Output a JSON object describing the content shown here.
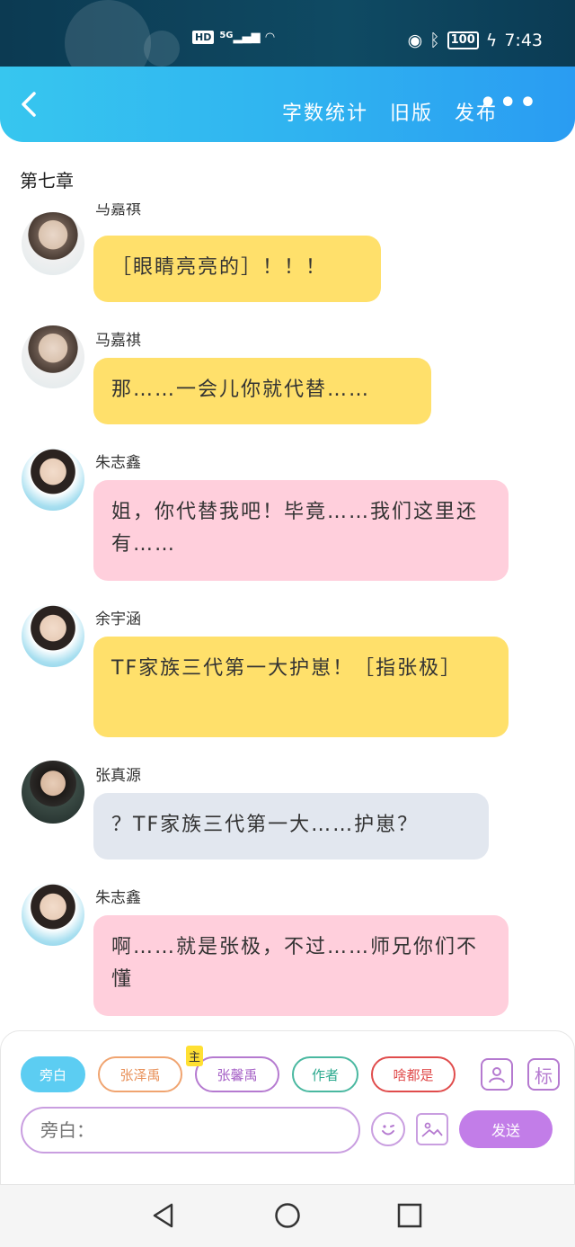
{
  "status_bar": {
    "network_badge": "HD",
    "signal_label": "5G",
    "battery": "100",
    "time": "7:43"
  },
  "title_bar": {
    "actions": [
      "字数统计",
      "旧版",
      "发布"
    ],
    "more": "•••"
  },
  "chapter_title": "第七章",
  "messages": [
    {
      "name": "马嘉祺",
      "text": "［眼睛亮亮的］！！！",
      "color": "#ffe06b"
    },
    {
      "name": "马嘉祺",
      "text": "那……一会儿你就代替……",
      "color": "#ffe06b"
    },
    {
      "name": "朱志鑫",
      "text": "姐，你代替我吧！毕竟……我们这里还有……",
      "color": "#ffcfdc"
    },
    {
      "name": "余宇涵",
      "text": "TF家族三代第一大护崽！［指张极］",
      "color": "#ffe06b"
    },
    {
      "name": "张真源",
      "text": "？TF家族三代第一大……护崽？",
      "color": "#e2e7ef"
    },
    {
      "name": "朱志鑫",
      "text": "啊……就是张极，不过……师兄你们不懂",
      "color": "#ffcfdc"
    }
  ],
  "input_panel": {
    "chips": [
      "旁白",
      "张泽禹",
      "张馨禹",
      "作者",
      "啥都是"
    ],
    "main_badge": "主",
    "tag_icon_label": "标",
    "input_placeholder": "旁白：",
    "send_label": "发送"
  }
}
